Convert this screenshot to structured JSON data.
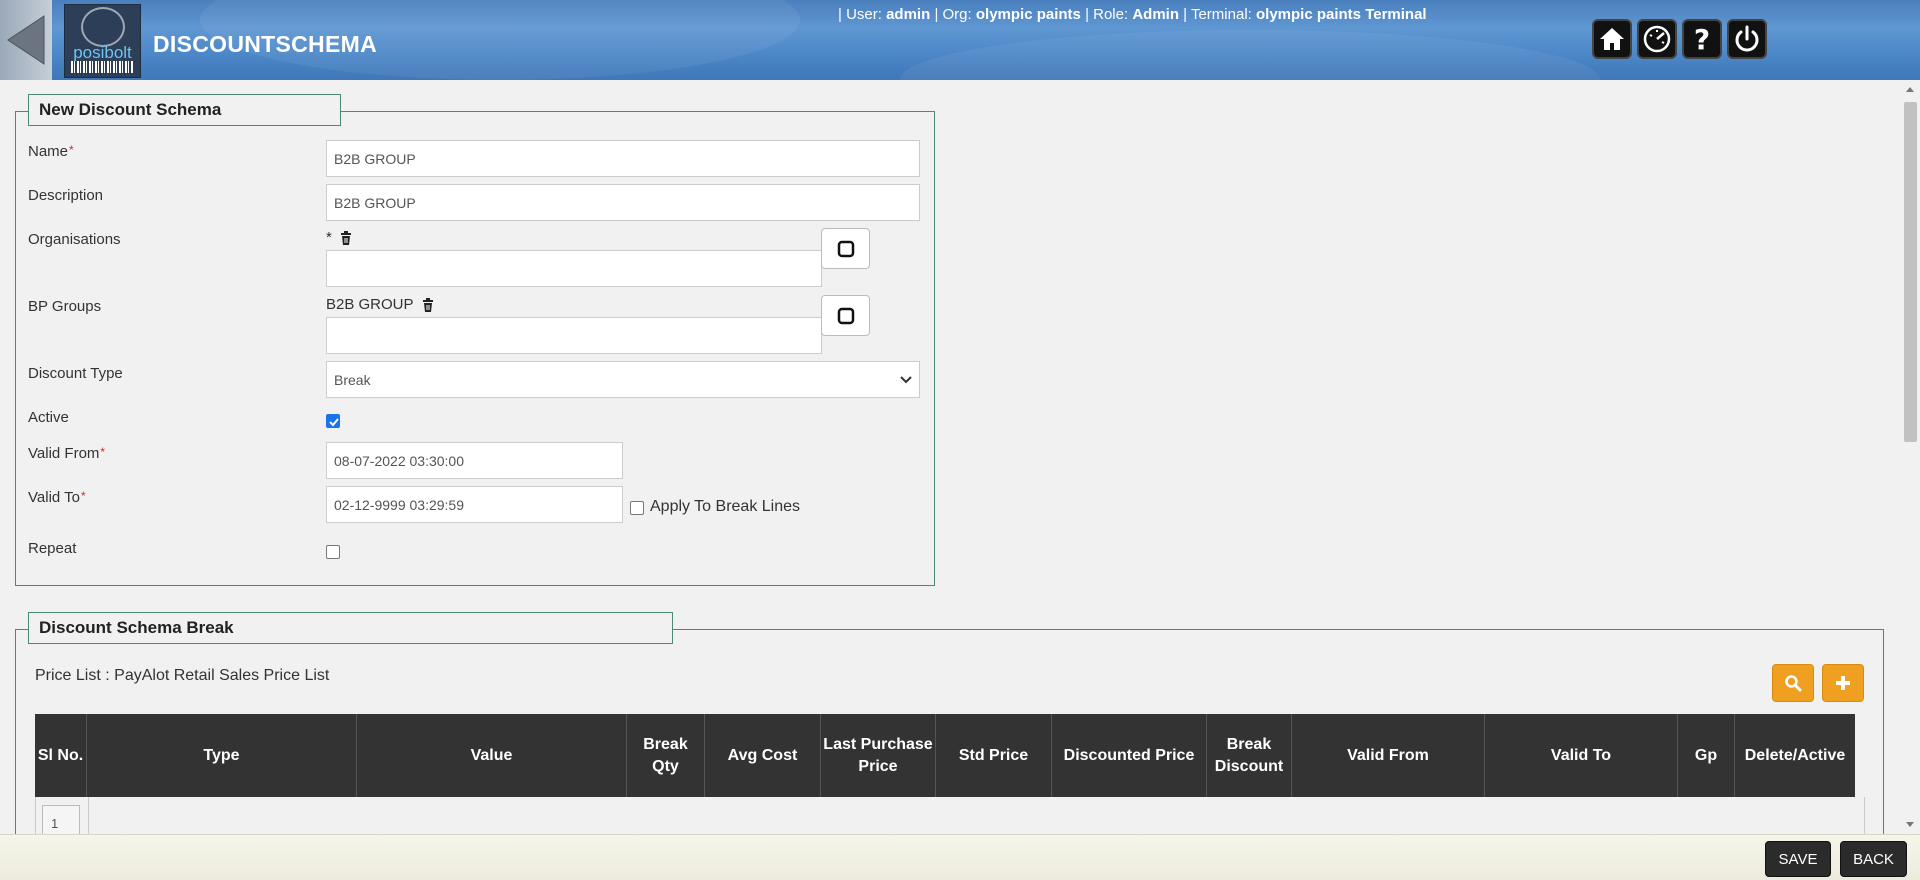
{
  "header": {
    "title": "DISCOUNTSCHEMA",
    "logo_text": "posibolt",
    "user_info": {
      "user_label": "| User:",
      "user": "admin",
      "org_label": "| Org:",
      "org": "olympic paints",
      "role_label": "| Role:",
      "role": "Admin",
      "terminal_label": "| Terminal:",
      "terminal": "olympic paints Terminal"
    },
    "icons": [
      "back-arrow-icon",
      "home-icon",
      "dashboard-icon",
      "help-icon",
      "power-icon"
    ]
  },
  "form": {
    "legend": "New Discount Schema",
    "name_label": "Name",
    "name_value": "B2B GROUP",
    "description_label": "Description",
    "description_value": "B2B GROUP",
    "organisations_label": "Organisations",
    "organisations_tag": "*",
    "bp_groups_label": "BP Groups",
    "bp_groups_tag": "B2B GROUP",
    "discount_type_label": "Discount Type",
    "discount_type_value": "Break",
    "active_label": "Active",
    "active_checked": true,
    "valid_from_label": "Valid From",
    "valid_from_value": "08-07-2022 03:30:00",
    "valid_to_label": "Valid To",
    "valid_to_value": "02-12-9999 03:29:59",
    "apply_break_label": "Apply To Break Lines",
    "apply_break_checked": false,
    "repeat_label": "Repeat",
    "repeat_checked": false,
    "required_mark": "*"
  },
  "break_section": {
    "legend": "Discount Schema Break",
    "price_list_label": "Price List :",
    "price_list_value": "PayAlot Retail Sales Price List",
    "columns": [
      "Sl No.",
      "Type",
      "Value",
      "Break Qty",
      "Avg Cost",
      "Last Purchase Price",
      "Std Price",
      "Discounted Price",
      "Break Discount",
      "Valid From",
      "Valid To",
      "Gp",
      "Delete/Active"
    ],
    "first_row_number": "1"
  },
  "footer": {
    "save_label": "SAVE",
    "back_label": "BACK"
  },
  "colors": {
    "header_blue": "#4a86c7",
    "panel_border": "#4a8a74",
    "table_header": "#333333",
    "orange_button": "#f0a021",
    "checkbox_blue": "#1a73e8"
  }
}
